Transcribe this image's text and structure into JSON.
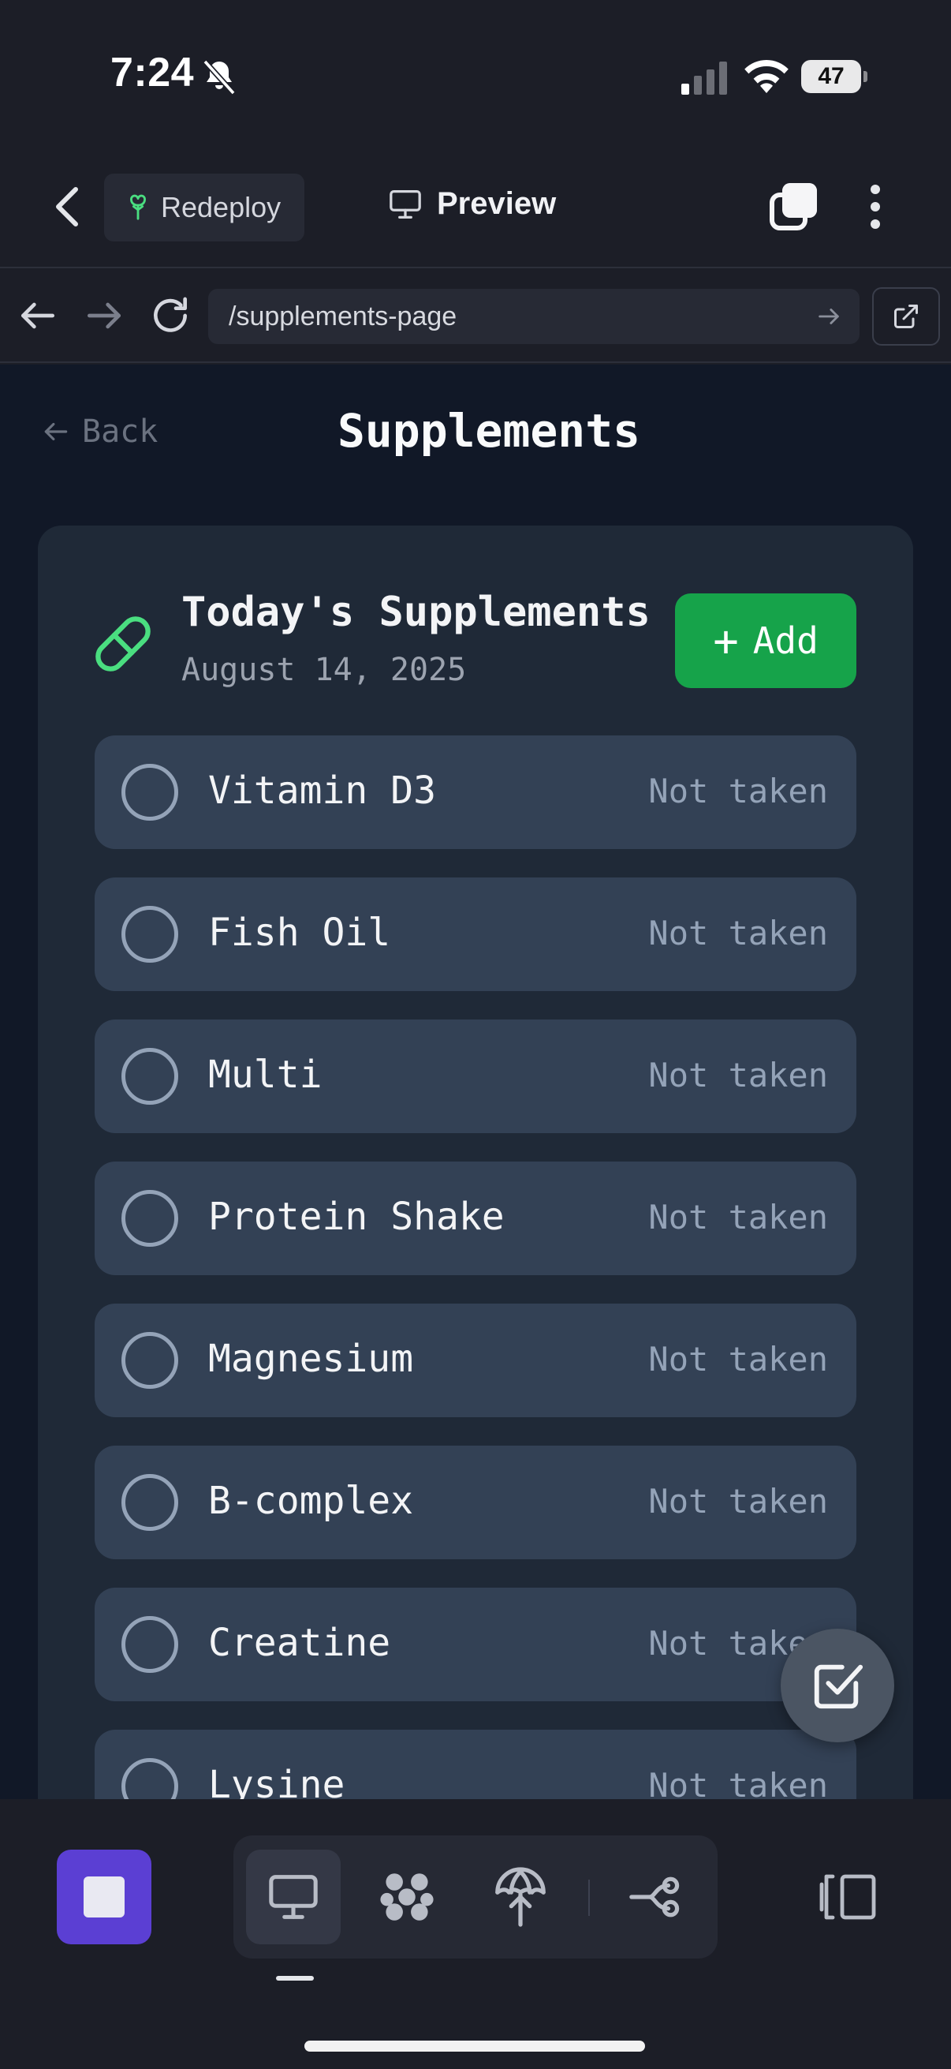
{
  "status_bar": {
    "time": "7:24",
    "battery": "47"
  },
  "header": {
    "redeploy_label": "Redeploy",
    "preview_label": "Preview"
  },
  "browser": {
    "url": "/supplements-page"
  },
  "page": {
    "back_label": "Back",
    "title": "Supplements",
    "card": {
      "title": "Today's Supplements",
      "date": "August 14, 2025",
      "add_label": "Add",
      "items": [
        {
          "name": "Vitamin D3",
          "status": "Not taken"
        },
        {
          "name": "Fish Oil",
          "status": "Not taken"
        },
        {
          "name": "Multi",
          "status": "Not taken"
        },
        {
          "name": "Protein Shake",
          "status": "Not taken"
        },
        {
          "name": "Magnesium",
          "status": "Not taken"
        },
        {
          "name": "B-complex",
          "status": "Not taken"
        },
        {
          "name": "Creatine",
          "status": "Not taken"
        },
        {
          "name": "Lysine",
          "status": "Not taken"
        }
      ]
    }
  },
  "colors": {
    "accent_green": "#16a34a",
    "pill_icon_green": "#4ade80",
    "stop_button_purple": "#5b3fd3",
    "card_bg": "#1f2937",
    "item_bg": "#334155"
  },
  "icons": {
    "status": [
      "bell-slash-icon",
      "signal-icon",
      "wifi-icon",
      "battery-icon"
    ],
    "header": [
      "chevron-left-icon",
      "tree-icon",
      "monitor-icon",
      "tabs-icon",
      "more-vertical-icon"
    ],
    "browser": [
      "arrow-left-icon",
      "arrow-right-icon",
      "reload-icon",
      "arrow-right-icon",
      "external-link-icon"
    ],
    "toolbar": [
      "stop-icon",
      "monitor-icon",
      "blob-icon",
      "deploy-icon",
      "share-nodes-icon",
      "panel-icon"
    ],
    "fab": "checkbox-icon"
  }
}
